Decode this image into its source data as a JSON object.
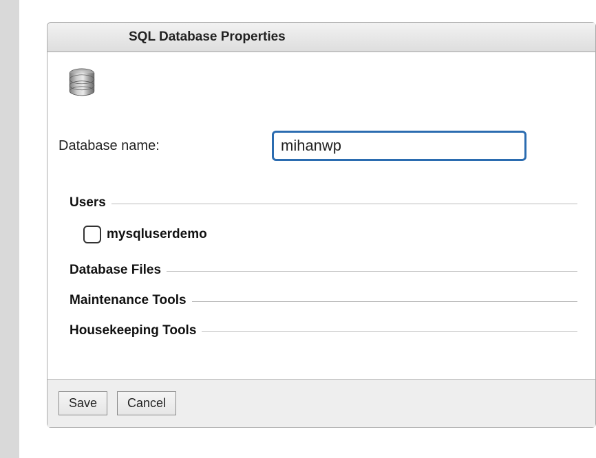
{
  "dialog": {
    "title": "SQL Database Properties"
  },
  "field": {
    "dbname_label": "Database name:",
    "dbname_value": "mihanwp"
  },
  "sections": {
    "users_title": "Users",
    "dbfiles_title": "Database Files",
    "maint_title": "Maintenance Tools",
    "housekeeping_title": "Housekeeping Tools"
  },
  "users": [
    {
      "name": "mysqluserdemo",
      "checked": false
    }
  ],
  "footer": {
    "save_label": "Save",
    "cancel_label": "Cancel"
  }
}
